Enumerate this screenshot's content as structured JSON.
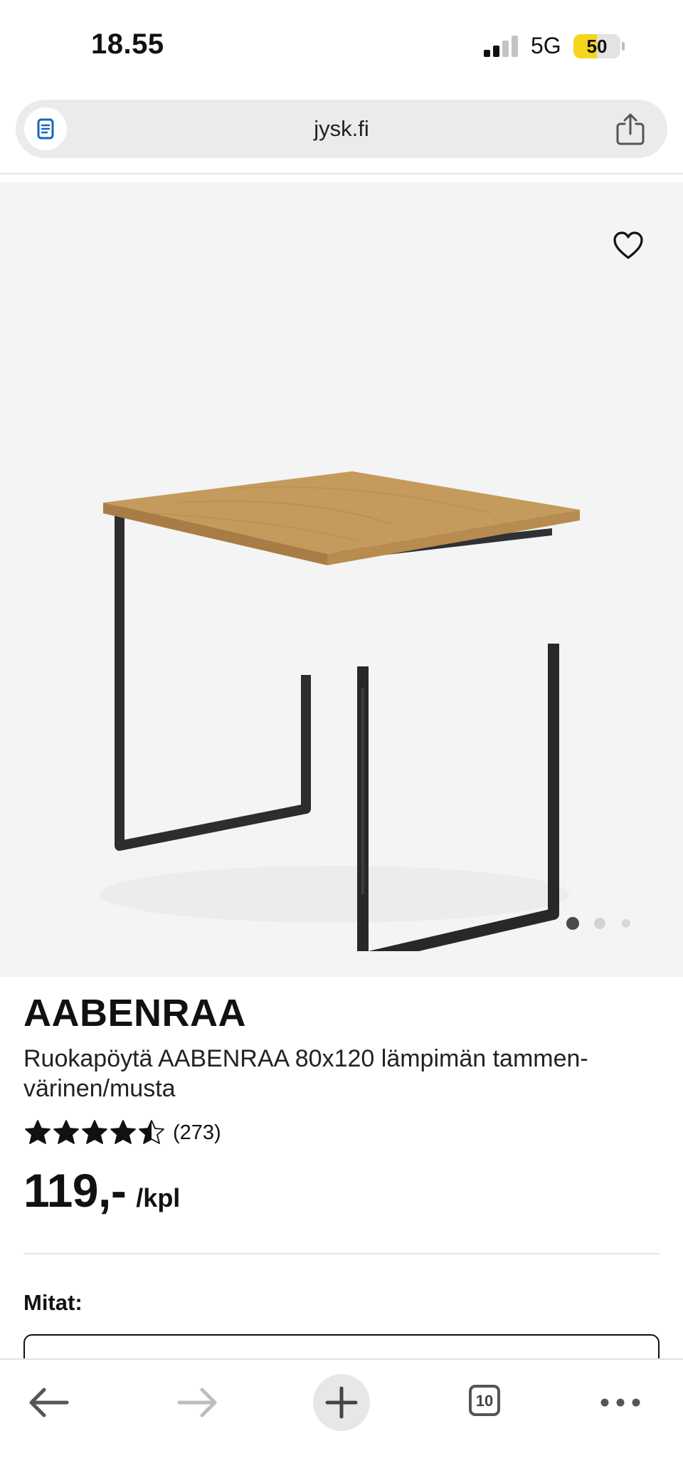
{
  "status_bar": {
    "time": "18.55",
    "network": "5G",
    "battery_level": "50",
    "battery_fraction": 0.5,
    "battery_color": "#f7d51d"
  },
  "browser": {
    "url": "jysk.fi",
    "reader_icon": "document-icon",
    "share_icon": "share-icon"
  },
  "gallery": {
    "favorite_icon": "heart-icon",
    "image_count": 3,
    "active_index": 0,
    "background": "#f4f4f4"
  },
  "product": {
    "brand": "AABENRAA",
    "description": "Ruokapöytä AABENRAA 80x120 lämpimän tammen-värinen/musta",
    "rating": 4.5,
    "rating_max": 5,
    "review_count": "(273)",
    "price": "119,-",
    "price_unit": "/kpl",
    "dimensions_label": "Mitat:"
  },
  "toolbar": {
    "back_icon": "arrow-left-icon",
    "forward_icon": "arrow-right-icon",
    "new_tab_icon": "plus-icon",
    "tabs_count": "10",
    "more_icon": "ellipsis-icon"
  }
}
